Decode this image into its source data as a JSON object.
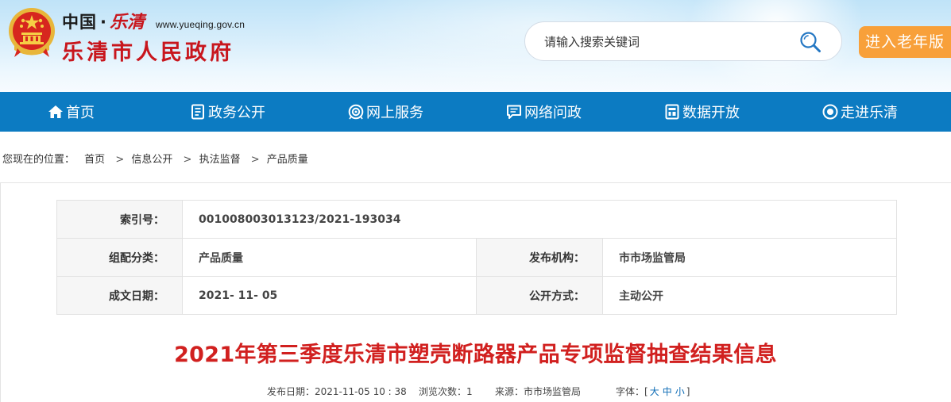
{
  "header": {
    "logo_country": "中国",
    "logo_dot": "·",
    "logo_city_calligraphy": "乐清",
    "logo_url": "www.yueqing.gov.cn",
    "logo_main": "乐清市人民政府",
    "search_placeholder": "请输入搜索关键词",
    "elder_button": "进入老年版"
  },
  "nav": {
    "items": [
      {
        "label": "首页",
        "icon": "home-icon"
      },
      {
        "label": "政务公开",
        "icon": "document-icon"
      },
      {
        "label": "网上服务",
        "icon": "service-icon"
      },
      {
        "label": "网络问政",
        "icon": "chat-icon"
      },
      {
        "label": "数据开放",
        "icon": "data-icon"
      },
      {
        "label": "走进乐清",
        "icon": "eye-icon"
      }
    ]
  },
  "breadcrumb": {
    "label": "您现在的位置：",
    "items": [
      "首页",
      "信息公开",
      "执法监督",
      "产品质量"
    ],
    "separator": ">"
  },
  "meta": {
    "index_label": "索引号：",
    "index_value": "001008003013123/2021-193034",
    "category_label": "组配分类：",
    "category_value": "产品质量",
    "publisher_label": "发布机构：",
    "publisher_value": "市市场监管局",
    "date_label": "成文日期：",
    "date_value": "2021- 11- 05",
    "mode_label": "公开方式：",
    "mode_value": "主动公开"
  },
  "article": {
    "title": "2021年第三季度乐清市塑壳断路器产品专项监督抽查结果信息",
    "publish_label": "发布日期：",
    "publish_value": "2021-11-05 10 : 38",
    "views_label": "浏览次数：",
    "views_value": "1",
    "source_label": "来源：",
    "source_value": "市市场监管局",
    "font_label": "字体：",
    "font_open": "[",
    "font_large": "大",
    "font_medium": "中",
    "font_small": "小",
    "font_close": "]"
  },
  "colors": {
    "nav_blue": "#0c7bc2",
    "title_red": "#d1201f",
    "elder_orange": "#f8a03a",
    "logo_red": "#c8161d"
  }
}
